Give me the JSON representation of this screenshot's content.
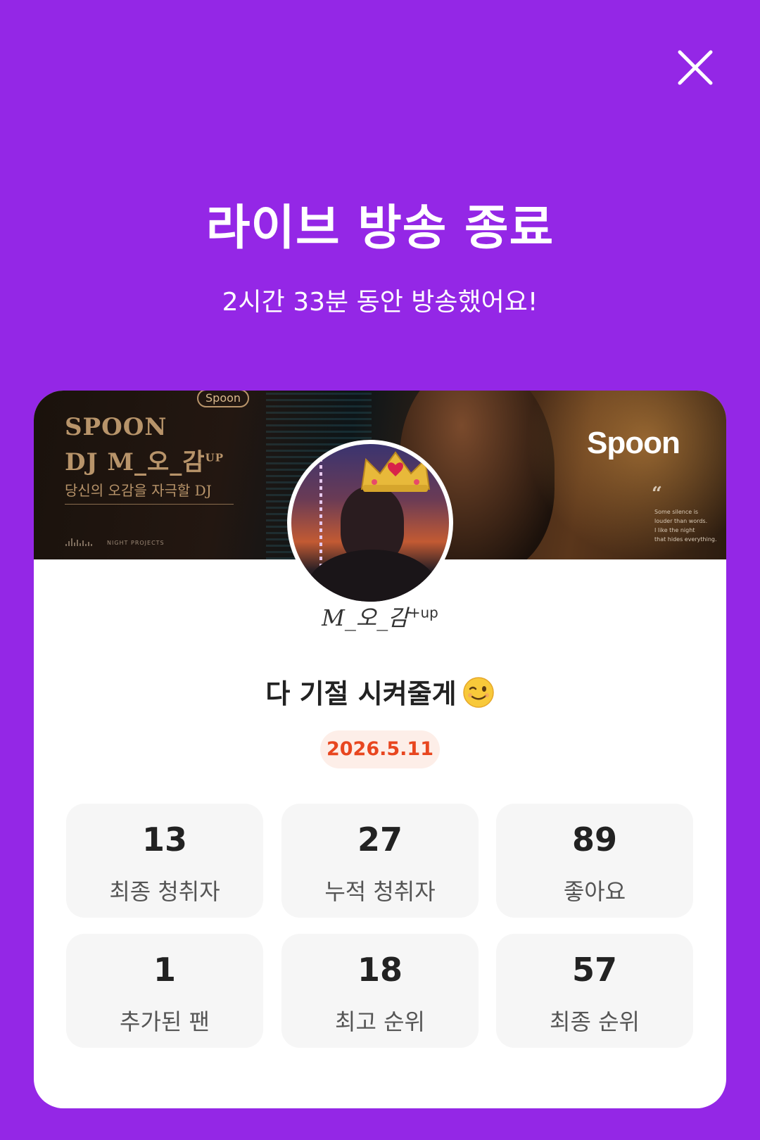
{
  "header": {
    "title": "라이브 방송 종료",
    "subtitle": "2시간 33분 동안 방송했어요!"
  },
  "banner": {
    "badge": "Spoon",
    "line1": "SPOON",
    "line2": "DJ M_오_감",
    "line2_sup": "UP",
    "tagline": "당신의 오감을 자극할 DJ",
    "credit": "NIGHT PROJECTS",
    "logo": "Spoon",
    "quote": "Some silence is\nlouder than words.\nI like the night\nthat hides everything."
  },
  "profile": {
    "nickname_main": "M_오_감",
    "nickname_sup": "+up"
  },
  "broadcast": {
    "title": "다 기절 시켜줄게",
    "title_emoji": "winking-face",
    "date": "2026.5.11"
  },
  "stats": [
    {
      "value": "13",
      "label": "최종 청취자"
    },
    {
      "value": "27",
      "label": "누적 청취자"
    },
    {
      "value": "89",
      "label": "좋아요"
    },
    {
      "value": "1",
      "label": "추가된 팬"
    },
    {
      "value": "18",
      "label": "최고 순위"
    },
    {
      "value": "57",
      "label": "최종 순위"
    }
  ],
  "colors": {
    "background": "#9427e6",
    "card": "#ffffff",
    "date_text": "#e8461f",
    "date_bg": "#fdeee8",
    "stat_bg": "#f6f6f6"
  }
}
